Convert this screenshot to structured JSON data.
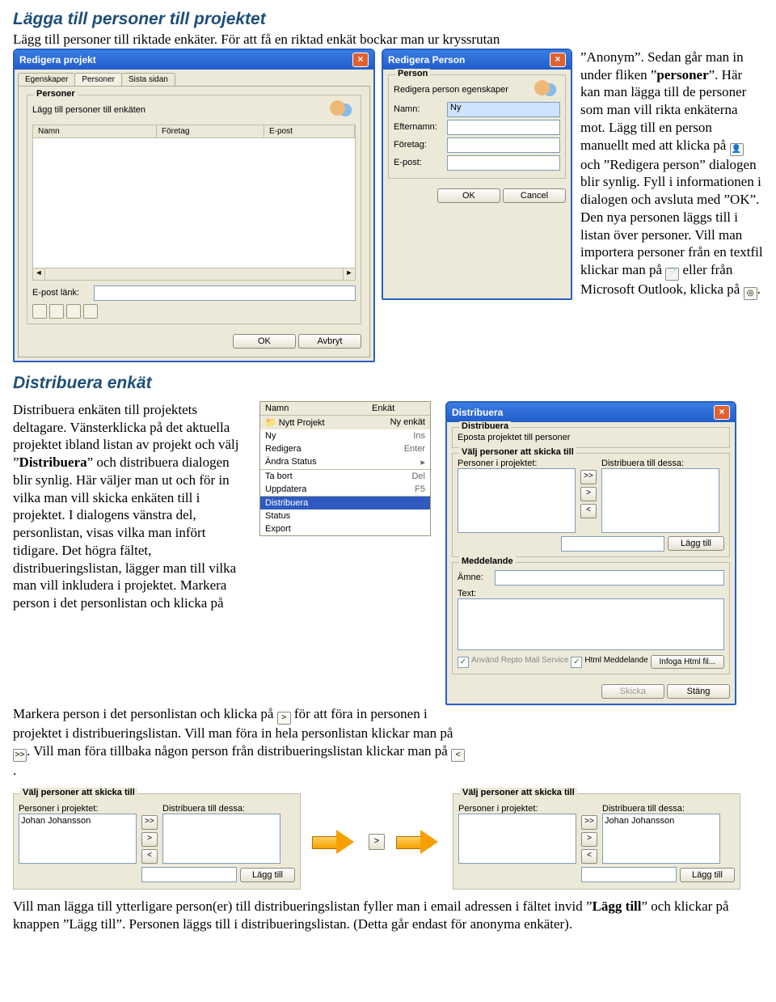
{
  "section1_title": "Lägga till personer till projektet",
  "section1_intro": "Lägg till personer till riktade enkäter. För att få en riktad enkät bockar man ur kryssrutan",
  "section1_para_parts": {
    "a": "”Anonym”. Sedan går man in under fliken ”",
    "b_bold": "personer",
    "c": "”. Här kan man lägga till de personer som man vill rikta enkäterna mot. Lägg till en person manuellt med att klicka på ",
    "d": " och ”Redigera person” dialogen blir synlig. Fyll i informationen i dialogen och avsluta med ”OK”. Den nya personen läggs till i listan över personer. Vill man importera personer från en textfil klickar man på ",
    "e": " eller från Microsoft Outlook, klicka på ",
    "f": "."
  },
  "redigera_projekt": {
    "title": "Redigera projekt",
    "tabs": [
      "Egenskaper",
      "Personer",
      "Sista sidan"
    ],
    "group_title": "Personer",
    "group_sub": "Lägg till personer till enkäten",
    "columns": [
      "Namn",
      "Företag",
      "E-post"
    ],
    "epost_lank": "E-post länk:",
    "ok": "OK",
    "cancel": "Avbryt"
  },
  "redigera_person": {
    "title": "Redigera Person",
    "group_title": "Person",
    "group_sub": "Redigera person egenskaper",
    "fields": {
      "namn": "Namn:",
      "efternamn": "Efternamn:",
      "foretag": "Företag:",
      "epost": "E-post:"
    },
    "namn_value": "Ny",
    "ok": "OK",
    "cancel": "Cancel"
  },
  "section2_title": "Distribuera enkät",
  "section2_para_parts": {
    "a": "Distribuera enkäten till projektets deltagare. Vänsterklicka på det aktuella projektet ibland listan av projekt och välj ”",
    "a_bold": "Distribuera",
    "b": "” och distribuera dialogen blir synlig. Här väljer man ut och för in vilka man vill skicka enkäten till i projektet. I dialogens vänstra del, personlistan, visas vilka man infört tidigare. Det högra fältet, distribueringslistan, lägger man till vilka man vill inkludera i projektet. Markera person i det personlistan och klicka på ",
    "c": " för att föra in personen i projektet i distribueringslistan. Vill man föra in hela personlistan klickar man på ",
    "d": ". Vill man föra tillbaka någon person från distribueringslistan klickar man på ",
    "e": "."
  },
  "ctx": {
    "head_name": "Namn",
    "head_enkat": "Enkät",
    "row1_name": "Nytt Projekt",
    "row1_enkat": "Ny enkät",
    "items": [
      {
        "label": "Ny",
        "shortcut": "Ins"
      },
      {
        "label": "Redigera",
        "shortcut": "Enter"
      },
      {
        "label": "Ändra Status",
        "shortcut": "▸"
      },
      {
        "label": "Ta bort",
        "shortcut": "Del"
      },
      {
        "label": "Uppdatera",
        "shortcut": "F5"
      },
      {
        "label": "Distribuera",
        "shortcut": "",
        "selected": true
      },
      {
        "label": "Status",
        "shortcut": ""
      },
      {
        "label": "Export",
        "shortcut": ""
      }
    ]
  },
  "dist": {
    "title": "Distribuera",
    "group_title": "Distribuera",
    "group_sub": "Eposta projektet till personer",
    "pick_title": "Välj personer att skicka till",
    "left_label": "Personer i projektet:",
    "right_label": "Distribuera till dessa:",
    "lagg_till": "Lägg till",
    "meddelande": "Meddelande",
    "amne": "Ämne:",
    "text": "Text:",
    "repto": "Använd Repto Mail Service",
    "html_msg": "Html Meddelande",
    "infoga": "Infoga Html fil...",
    "skicka": "Skicka",
    "stang": "Stäng"
  },
  "before_after": {
    "group_title": "Välj personer att skicka till",
    "left_label": "Personer i projektet:",
    "right_label": "Distribuera till dessa:",
    "person_name": "Johan Johansson",
    "lagg_till": "Lägg till"
  },
  "footer_parts": {
    "a": "Vill man lägga till ytterligare person(er) till distribueringslistan fyller man i email adressen i fältet invid ”",
    "b_bold": "Lägg till",
    "c": "” och klickar på knappen ”Lägg till”. Personen läggs till i distribueringslistan. (Detta går endast för anonyma enkäter)."
  }
}
